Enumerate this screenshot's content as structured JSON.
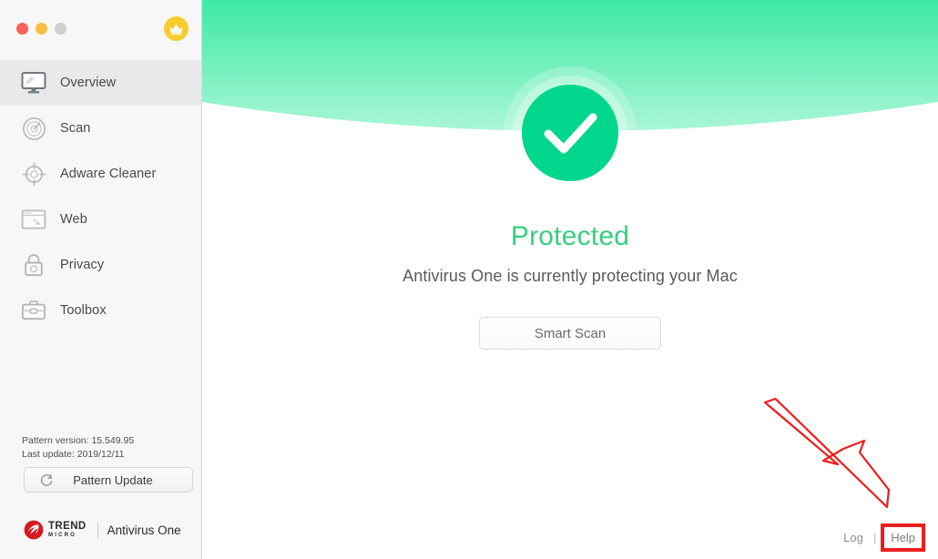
{
  "window": {
    "traffic_lights": [
      {
        "name": "close",
        "color": "#fc6058"
      },
      {
        "name": "minimize",
        "color": "#fdbc40"
      },
      {
        "name": "zoom",
        "color": "#cfcfcf"
      }
    ],
    "premium_badge_icon": "crown-icon",
    "premium_badge_color": "#f9cc2e"
  },
  "sidebar": {
    "items": [
      {
        "label": "Overview",
        "icon": "monitor-icon",
        "active": true
      },
      {
        "label": "Scan",
        "icon": "radar-scan-icon",
        "active": false
      },
      {
        "label": "Adware Cleaner",
        "icon": "crosshair-icon",
        "active": false
      },
      {
        "label": "Web",
        "icon": "browser-window-icon",
        "active": false
      },
      {
        "label": "Privacy",
        "icon": "padlock-icon",
        "active": false
      },
      {
        "label": "Toolbox",
        "icon": "briefcase-icon",
        "active": false
      }
    ],
    "pattern_version_line": "Pattern version: 15.549.95",
    "last_update_line": "Last update: 2019/12/11",
    "pattern_update_button": "Pattern Update",
    "pattern_update_icon": "refresh-icon",
    "brand": {
      "logo_icon": "trend-micro-logo-icon",
      "company_line1": "TREND",
      "company_line2": "MICRO",
      "product": "Antivirus One"
    }
  },
  "main": {
    "status_icon": "check-circle-icon",
    "status_title": "Protected",
    "status_title_color": "#36cf7e",
    "status_subtitle": "Antivirus One is currently protecting your Mac",
    "smart_scan_button": "Smart Scan",
    "hero_gradient_top": "#3fe9a7",
    "hero_gradient_bottom": "#a8f5d4",
    "check_circle_color": "#00d78c"
  },
  "footer": {
    "log_label": "Log",
    "separator": "|",
    "help_label": "Help"
  },
  "annotation": {
    "arrow_icon": "arrow-pointing-down-right-icon",
    "arrow_color": "#ee1d1d",
    "highlight_color": "#ee1d1d",
    "highlight_target": "Help"
  }
}
